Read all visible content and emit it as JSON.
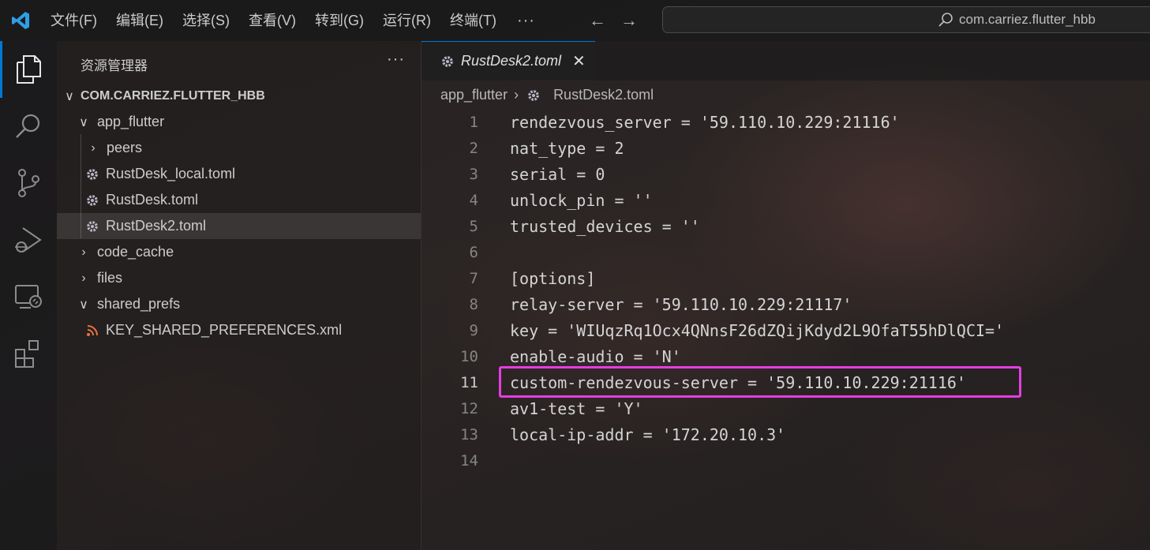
{
  "titlebar": {
    "menus": [
      "文件(F)",
      "编辑(E)",
      "选择(S)",
      "查看(V)",
      "转到(G)",
      "运行(R)",
      "终端(T)"
    ],
    "more": "···",
    "back": "←",
    "forward": "→",
    "search_text": "com.carriez.flutter_hbb"
  },
  "activitybar": {
    "icons": [
      "explorer-icon",
      "search-icon",
      "source-control-icon",
      "run-debug-icon",
      "remote-explorer-icon",
      "extensions-icon"
    ]
  },
  "sidebar": {
    "header": "资源管理器",
    "more": "···",
    "root": "COM.CARRIEZ.FLUTTER_HBB",
    "items": [
      {
        "label": "app_flutter",
        "chevron": "∨"
      },
      {
        "label": "peers",
        "chevron": "›"
      },
      {
        "label": "RustDesk_local.toml"
      },
      {
        "label": "RustDesk.toml"
      },
      {
        "label": "RustDesk2.toml"
      },
      {
        "label": "code_cache",
        "chevron": "›"
      },
      {
        "label": "files",
        "chevron": "›"
      },
      {
        "label": "shared_prefs",
        "chevron": "∨"
      },
      {
        "label": "KEY_SHARED_PREFERENCES.xml"
      }
    ]
  },
  "editor": {
    "tab": {
      "label": "RustDesk2.toml",
      "close": "✕"
    },
    "breadcrumb": {
      "folder": "app_flutter",
      "sep": "›",
      "file": "RustDesk2.toml"
    },
    "current_line": 11,
    "lines": [
      {
        "n": "1",
        "text": "rendezvous_server = '59.110.10.229:21116'"
      },
      {
        "n": "2",
        "text": "nat_type = 2"
      },
      {
        "n": "3",
        "text": "serial = 0"
      },
      {
        "n": "4",
        "text": "unlock_pin = ''"
      },
      {
        "n": "5",
        "text": "trusted_devices = ''"
      },
      {
        "n": "6",
        "text": ""
      },
      {
        "n": "7",
        "text": "[options]"
      },
      {
        "n": "8",
        "text": "relay-server = '59.110.10.229:21117'"
      },
      {
        "n": "9",
        "text": "key = 'WIUqzRq1Ocx4QNnsF26dZQijKdyd2L9OfaT55hDlQCI='"
      },
      {
        "n": "10",
        "text": "enable-audio = 'N'"
      },
      {
        "n": "11",
        "text": "custom-rendezvous-server = '59.110.10.229:21116'"
      },
      {
        "n": "12",
        "text": "av1-test = 'Y'"
      },
      {
        "n": "13",
        "text": "local-ip-addr = '172.20.10.3'"
      },
      {
        "n": "14",
        "text": ""
      }
    ]
  },
  "colors": {
    "accent": "#0078d4",
    "highlight_box": "#e53de2",
    "vscode_logo": "#2f9ee8",
    "rss_icon": "#e8733d"
  }
}
